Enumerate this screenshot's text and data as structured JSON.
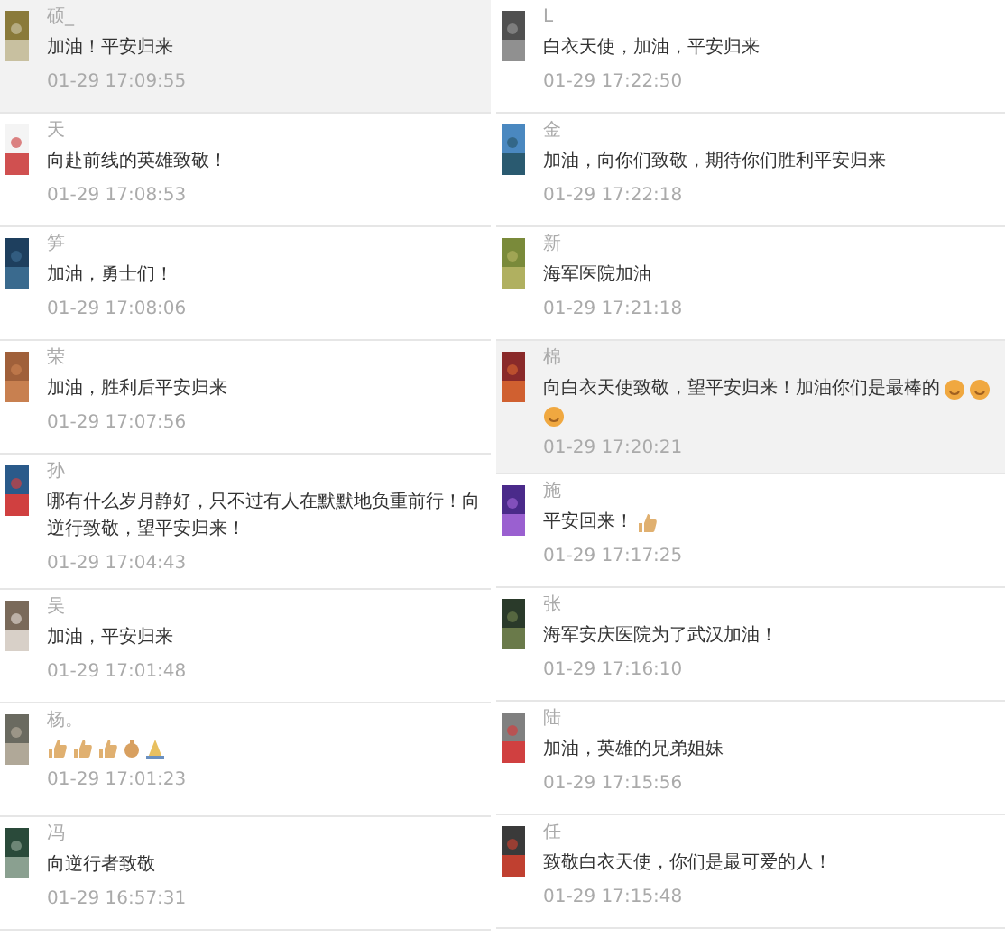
{
  "columns": [
    {
      "comments": [
        {
          "name": "硕_",
          "text": "加油！平安归来",
          "time": "01-29 17:09:55",
          "highlighted": true
        },
        {
          "name": "天",
          "text": "向赴前线的英雄致敬！",
          "time": "01-29 17:08:53",
          "highlighted": false
        },
        {
          "name": "笋",
          "text": "加油，勇士们！",
          "time": "01-29 17:08:06",
          "highlighted": false
        },
        {
          "name": "荣",
          "text": "加油，胜利后平安归来",
          "time": "01-29 17:07:56",
          "highlighted": false
        },
        {
          "name": "孙",
          "text": "哪有什么岁月静好，只不过有人在默默地负重前行！向逆行致敬，望平安归来！",
          "time": "01-29 17:04:43",
          "highlighted": false
        },
        {
          "name": "吴",
          "text": "加油，平安归来",
          "time": "01-29 17:01:48",
          "highlighted": false
        },
        {
          "name": "杨。",
          "emoji": [
            {
              "kind": "thumb"
            },
            {
              "kind": "thumb"
            },
            {
              "kind": "thumb"
            },
            {
              "kind": "fist"
            },
            {
              "kind": "pray"
            }
          ],
          "time": "01-29 17:01:23",
          "highlighted": false
        },
        {
          "name": "冯",
          "text": "向逆行者致敬",
          "time": "01-29 16:57:31",
          "highlighted": false
        }
      ]
    },
    {
      "comments": [
        {
          "name": "L",
          "text": "白衣天使，加油，平安归来",
          "time": "01-29 17:22:50",
          "highlighted": false
        },
        {
          "name": "金",
          "text": "加油，向你们致敬，期待你们胜利平安归来",
          "time": "01-29 17:22:18",
          "highlighted": false
        },
        {
          "name": "新",
          "text": "海军医院加油",
          "time": "01-29 17:21:18",
          "highlighted": false
        },
        {
          "name": "棉",
          "text": "向白衣天使致敬，望平安归来！加油你们是最棒的",
          "emoji": [
            {
              "kind": "face"
            },
            {
              "kind": "face"
            },
            {
              "kind": "face"
            }
          ],
          "time": "01-29 17:20:21",
          "highlighted": true
        },
        {
          "name": "施",
          "text": "平安回来！",
          "emoji": [
            {
              "kind": "thumb"
            }
          ],
          "time": "01-29 17:17:25",
          "highlighted": false
        },
        {
          "name": "张",
          "text": "海军安庆医院为了武汉加油！",
          "time": "01-29 17:16:10",
          "highlighted": false
        },
        {
          "name": "陆",
          "text": "加油，英雄的兄弟姐妹",
          "time": "01-29 17:15:56",
          "highlighted": false
        },
        {
          "name": "任",
          "text": "致敬白衣天使，你们是最可爱的人！",
          "time": "01-29 17:15:48",
          "highlighted": false
        }
      ]
    }
  ]
}
